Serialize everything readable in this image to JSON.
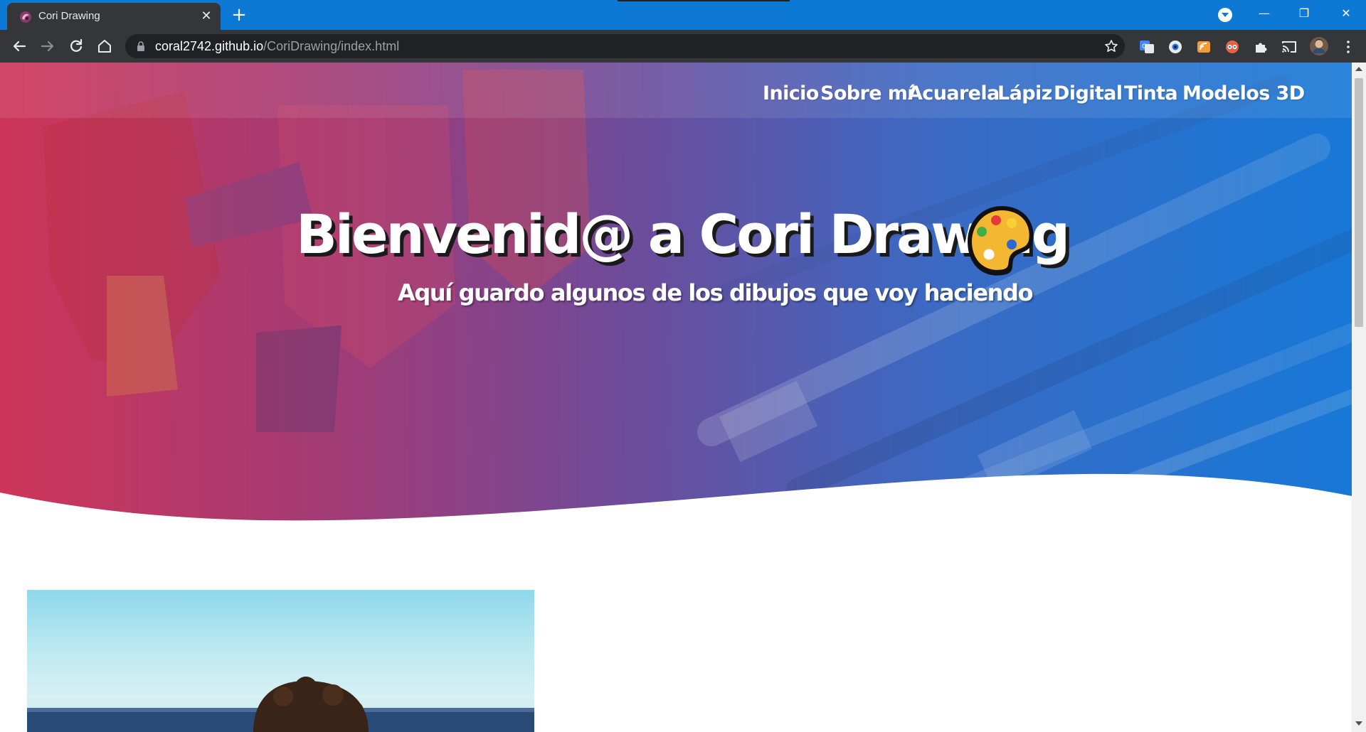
{
  "browser": {
    "tab_title": "Cori Drawing",
    "tab_close": "✕",
    "new_tab": "+",
    "url_host": "coral2742.github.io",
    "url_path": "/CoriDrawing/index.html",
    "window_controls": {
      "minimize": "—",
      "restore": "❐",
      "close": "✕"
    },
    "extensions": [
      "translate-icon",
      "eye-extension-icon",
      "rss-extension-icon",
      "glasses-extension-icon",
      "puzzle-icon",
      "cast-icon",
      "avatar",
      "kebab-menu-icon"
    ],
    "colors": {
      "titlebar": "#0e78d5",
      "toolbar": "#35363a",
      "omnibox": "#202124"
    }
  },
  "nav": {
    "items": [
      "Inicio",
      "Sobre mí",
      "Acuarela",
      "Lápiz",
      "Digital",
      "Tinta",
      "Modelos 3D"
    ]
  },
  "hero": {
    "title": "Bienvenid@ a Cori Drawing",
    "subtitle": "Aquí guardo algunos de los dibujos que voy haciendo",
    "emoji_icon": "artist-palette-icon",
    "colors": {
      "left": "#c9375c",
      "right": "#1d78d6"
    }
  }
}
